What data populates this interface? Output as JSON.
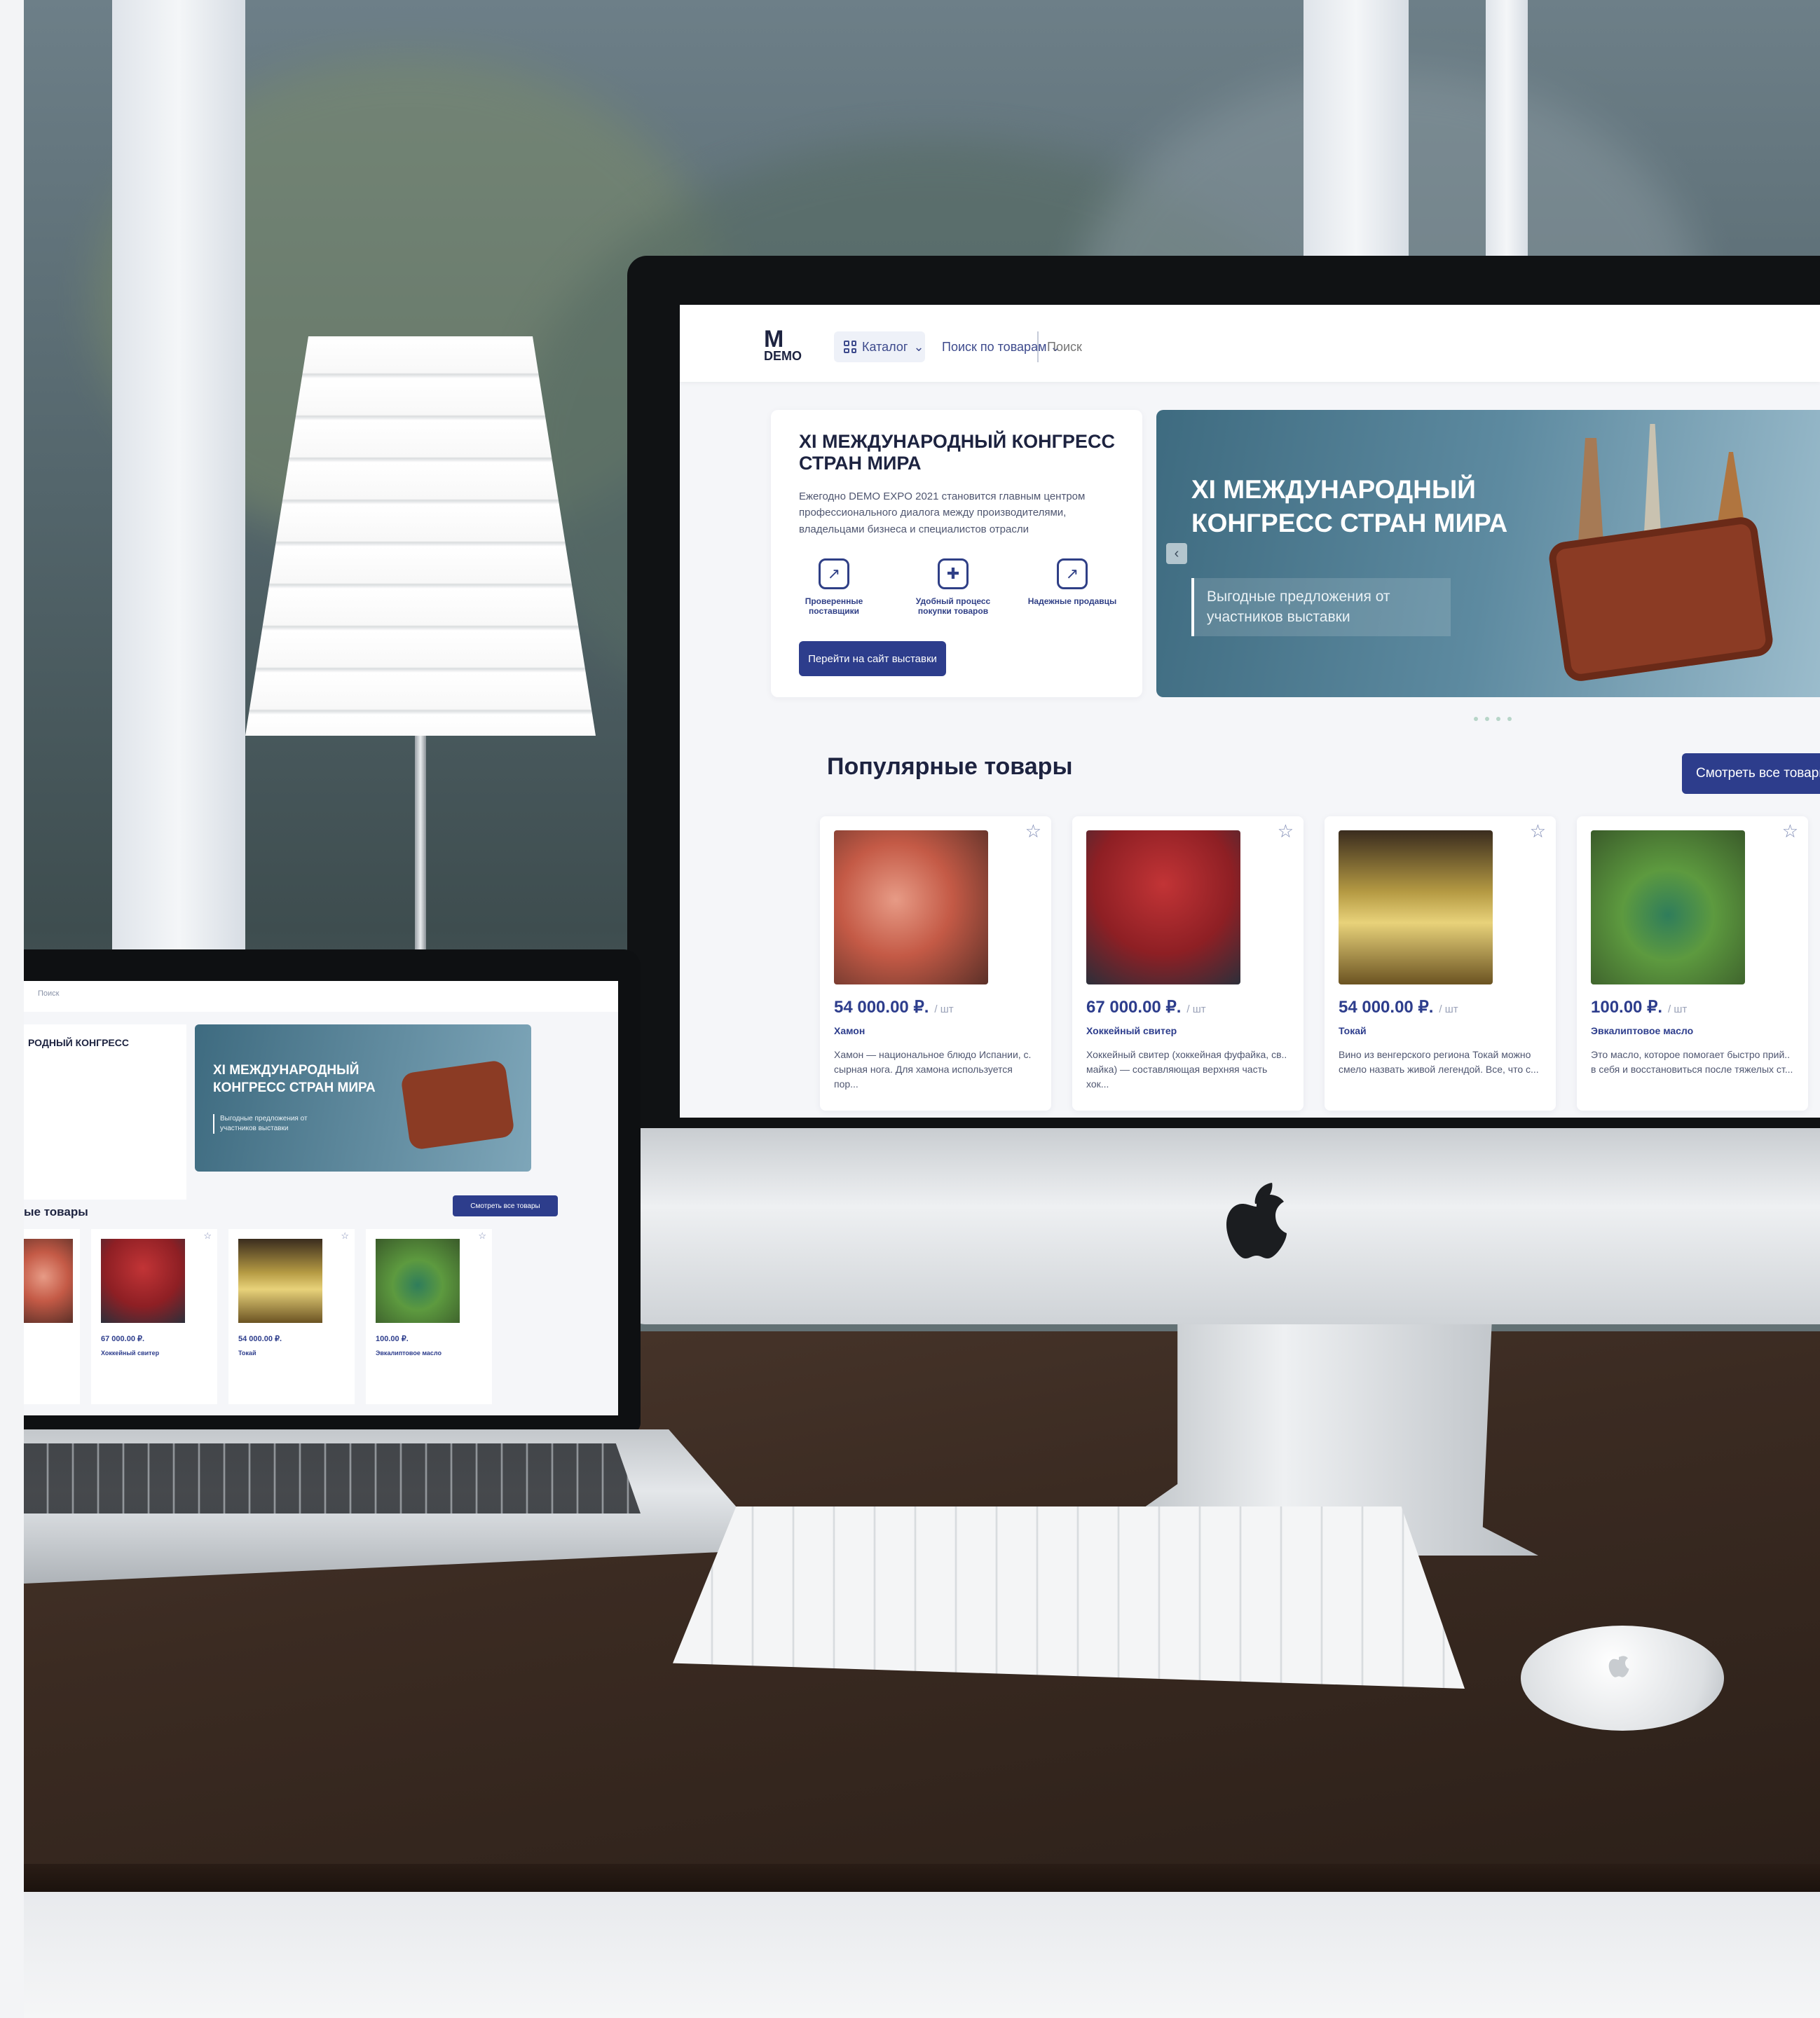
{
  "site": {
    "logo_text": "DEMO",
    "logo_mark": "M",
    "catalog_label": "Каталог",
    "search_scope": "Поиск по товарам",
    "search_placeholder": "Поиск",
    "intro": {
      "title": "XI МЕЖДУНАРОДНЫЙ КОНГРЕСС СТРАН МИРА",
      "text": "Ежегодно DEMO EXPO 2021 становится главным центром профессионального диалога между производителями, владельцами бизнеса и специалистов отрасли",
      "features": [
        {
          "label": "Проверенные поставщики",
          "icon": "chart-icon"
        },
        {
          "label": "Удобный процесс покупки товаров",
          "icon": "gamepad-icon"
        },
        {
          "label": "Надежные продавцы",
          "icon": "chart-icon"
        }
      ],
      "cta_label": "Перейти на сайт выставки"
    },
    "banner": {
      "title": "XI МЕЖДУНАРОДНЫЙ КОНГРЕСС СТРАН МИРА",
      "subtitle": "Выгодные предложения от участников выставки"
    },
    "popular": {
      "title": "Популярные товары",
      "view_all_label": "Смотреть все товары",
      "products": [
        {
          "price": "54 000.00 ₽.",
          "unit": "/ шт",
          "name": "Хамон",
          "desc": "Хамон — национальное блюдо Испании, с. сырная нога. Для хамона используется пор..."
        },
        {
          "price": "67 000.00 ₽.",
          "unit": "/ шт",
          "name": "Хоккейный свитер",
          "desc": "Хоккейный свитер (хоккейная фуфайка, св.. майка) — составляющая верхняя часть хок..."
        },
        {
          "price": "54 000.00 ₽.",
          "unit": "/ шт",
          "name": "Токай",
          "desc": "Вино из венгерского региона Токай можно смело назвать живой легендой. Все, что с..."
        },
        {
          "price": "100.00 ₽.",
          "unit": "/ шт",
          "name": "Эвкалиптовое масло",
          "desc": "Это масло, которое помогает быстро прий.. в себя и восстановиться после тяжелых ст..."
        }
      ]
    }
  },
  "laptop_site": {
    "search_scope": "Поиск",
    "intro_title": "РОДНЫЙ КОНГРЕСС",
    "banner_title": "XI МЕЖДУНАРОДНЫЙ КОНГРЕСС СТРАН МИРА",
    "banner_subtitle": "Выгодные предложения от участников выставки",
    "section_title": "ые товары",
    "view_all_label": "Смотреть все товары",
    "products": [
      {
        "price": "",
        "name": ""
      },
      {
        "price": "67 000.00 ₽.",
        "name": "Хоккейный свитер"
      },
      {
        "price": "54 000.00 ₽.",
        "name": "Токай"
      },
      {
        "price": "100.00 ₽.",
        "name": "Эвкалиптовое масло"
      }
    ]
  },
  "colors": {
    "accent": "#2d3d8c",
    "heading": "#1d2340",
    "banner": "#4a7a90"
  }
}
